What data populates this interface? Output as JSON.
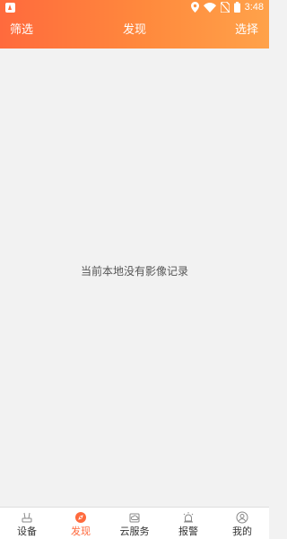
{
  "status_bar": {
    "time": "3:48"
  },
  "header": {
    "left_label": "筛选",
    "title": "发现",
    "right_label": "选择"
  },
  "main": {
    "empty_message": "当前本地没有影像记录"
  },
  "tabbar": {
    "items": [
      {
        "label": "设备",
        "icon": "device-icon",
        "active": false
      },
      {
        "label": "发现",
        "icon": "discover-icon",
        "active": true
      },
      {
        "label": "云服务",
        "icon": "cloud-service-icon",
        "active": false
      },
      {
        "label": "报警",
        "icon": "alarm-icon",
        "active": false
      },
      {
        "label": "我的",
        "icon": "profile-icon",
        "active": false
      }
    ]
  },
  "colors": {
    "accent": "#ff6a3d",
    "background": "#f2f2f2"
  }
}
